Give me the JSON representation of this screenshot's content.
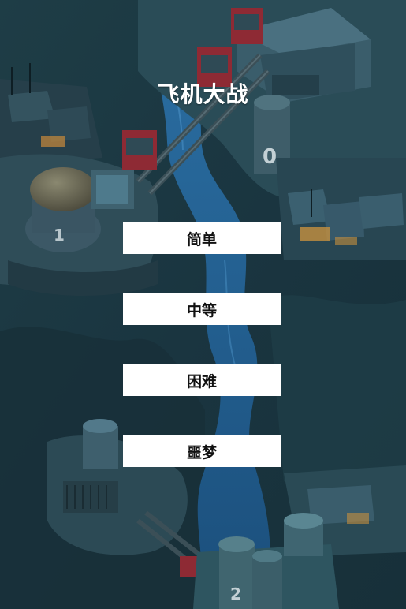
{
  "game": {
    "title": "飞机大战",
    "difficulty_buttons": [
      {
        "label": "简单"
      },
      {
        "label": "中等"
      },
      {
        "label": "困难"
      },
      {
        "label": "噩梦"
      }
    ]
  },
  "background": {
    "scene": "top-down night map with river, rooftops, pipes and bridges",
    "building_numbers": [
      "0",
      "1",
      "2"
    ],
    "colors": {
      "ground": "#1c3a44",
      "river": "#1e5b8a",
      "roof": "#2e4c5a",
      "accent_red": "#a8303a",
      "window_glow": "#d9a04a"
    }
  }
}
